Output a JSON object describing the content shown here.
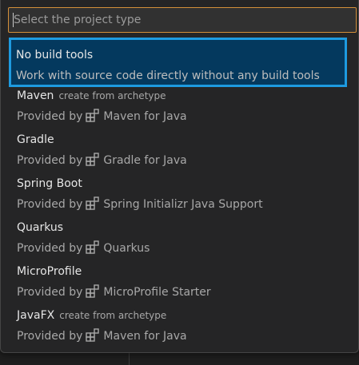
{
  "quickpick": {
    "placeholder": "Select the project type",
    "value": "",
    "items": [
      {
        "label": "No build tools",
        "description": "",
        "detail": "Work with source code directly without any build tools",
        "selected": true
      },
      {
        "label": "Maven",
        "description": "create from archetype",
        "detail_prefix": "Provided by",
        "detail_icon": "extensions-icon",
        "detail_name": "Maven for Java"
      },
      {
        "label": "Gradle",
        "description": "",
        "detail_prefix": "Provided by",
        "detail_icon": "extensions-icon",
        "detail_name": "Gradle for Java"
      },
      {
        "label": "Spring Boot",
        "description": "",
        "detail_prefix": "Provided by",
        "detail_icon": "extensions-icon",
        "detail_name": "Spring Initializr Java Support"
      },
      {
        "label": "Quarkus",
        "description": "",
        "detail_prefix": "Provided by",
        "detail_icon": "extensions-icon",
        "detail_name": "Quarkus"
      },
      {
        "label": "MicroProfile",
        "description": "",
        "detail_prefix": "Provided by",
        "detail_icon": "extensions-icon",
        "detail_name": "MicroProfile Starter"
      },
      {
        "label": "JavaFX",
        "description": "create from archetype",
        "detail_prefix": "Provided by",
        "detail_icon": "extensions-icon",
        "detail_name": "Maven for Java"
      }
    ]
  },
  "colors": {
    "focus_border": "#1e9be0",
    "input_border": "#d4903a",
    "selected_bg": "#04395e",
    "panel_bg": "#252526"
  }
}
